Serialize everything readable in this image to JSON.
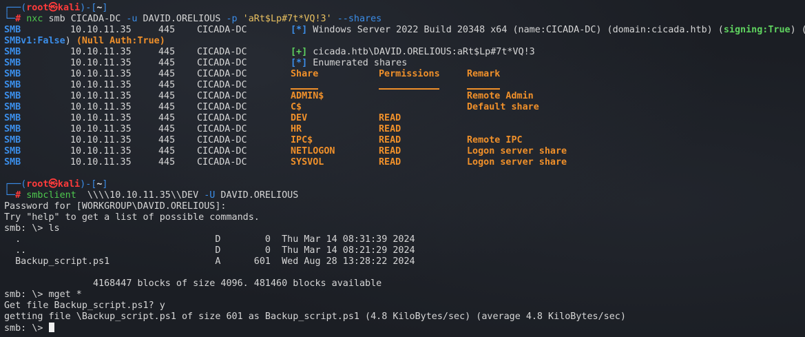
{
  "prompt": {
    "corner_top": "┌──",
    "corner_bottom": "└─",
    "open": "(",
    "user": "root",
    "skull": "㉿",
    "host": "kali",
    "close": ")-[",
    "dir": "~",
    "close2": "]",
    "hash": "#"
  },
  "cmd1": {
    "bin": "nxc",
    "args": " smb CICADA-DC ",
    "flag_u": "-u",
    "user": " DAVID.ORELIOUS ",
    "flag_p": "-p",
    "pass": " 'aRt$Lp#7t*VQ!3' ",
    "flag_s": "--shares"
  },
  "smb_proto": "SMB",
  "smb_ip": "10.10.11.35",
  "smb_port": "445",
  "smb_host": "CICADA-DC",
  "info": {
    "marker": "[*]",
    "text": " Windows Server 2022 Build 20348 x64 (name:CICADA-DC) (domain:cicada.htb) (",
    "signing": "signing:True",
    "after": ") (",
    "smbv1": "SMBv1:False",
    "null_open": ") ",
    "null": "(Null Auth:True)"
  },
  "auth": {
    "marker": "[+]",
    "text": " cicada.htb\\DAVID.ORELIOUS:aRt$Lp#7t*VQ!3"
  },
  "enum": {
    "marker": "[*]",
    "text": " Enumerated shares"
  },
  "share_headers": [
    "Share",
    "Permissions",
    "Remark"
  ],
  "shares": [
    {
      "name": "ADMIN$",
      "perm": "",
      "remark": "Remote Admin"
    },
    {
      "name": "C$",
      "perm": "",
      "remark": "Default share"
    },
    {
      "name": "DEV",
      "perm": "READ",
      "remark": ""
    },
    {
      "name": "HR",
      "perm": "READ",
      "remark": ""
    },
    {
      "name": "IPC$",
      "perm": "READ",
      "remark": "Remote IPC"
    },
    {
      "name": "NETLOGON",
      "perm": "READ",
      "remark": "Logon server share"
    },
    {
      "name": "SYSVOL",
      "perm": "READ",
      "remark": "Logon server share"
    }
  ],
  "cmd2": {
    "bin": "smbclient",
    "args": "  \\\\\\\\10.10.11.35\\\\DEV ",
    "flag": "-U",
    "user": " DAVID.ORELIOUS"
  },
  "output": [
    "Password for [WORKGROUP\\DAVID.ORELIOUS]:",
    "Try \"help\" to get a list of possible commands.",
    "smb: \\> ls",
    "  .                                   D        0  Thu Mar 14 08:31:39 2024",
    "  ..                                  D        0  Thu Mar 14 08:21:29 2024",
    "  Backup_script.ps1                   A      601  Wed Aug 28 13:28:22 2024",
    "",
    "                4168447 blocks of size 4096. 481460 blocks available",
    "smb: \\> mget *",
    "Get file Backup_script.ps1? y",
    "getting file \\Backup_script.ps1 of size 601 as Backup_script.ps1 (4.8 KiloBytes/sec) (average 4.8 KiloBytes/sec)"
  ],
  "last_prompt": "smb: \\> "
}
